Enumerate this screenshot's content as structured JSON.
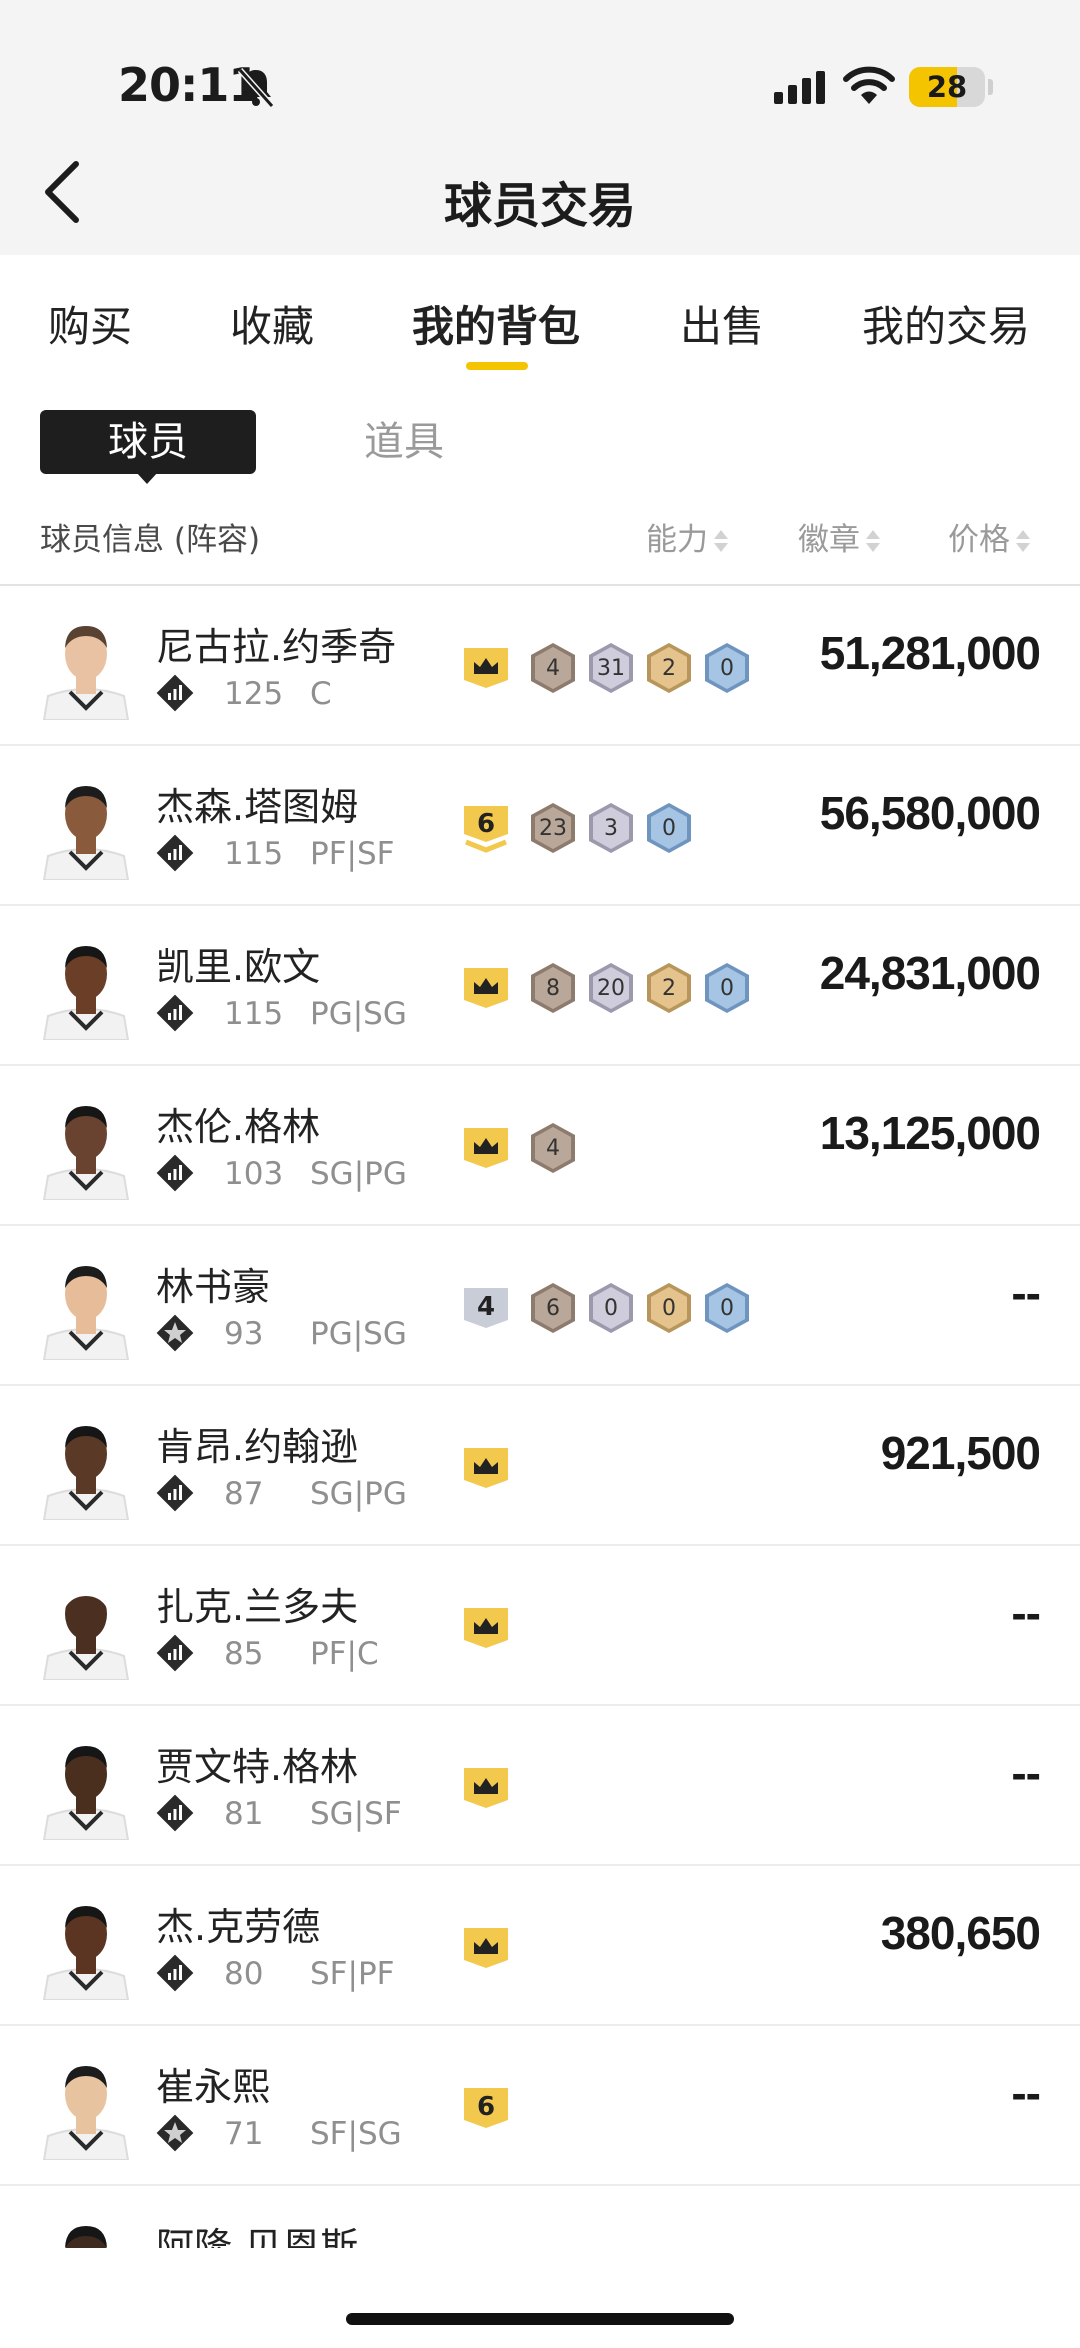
{
  "status_bar": {
    "time": "20:11",
    "battery": "28"
  },
  "header": {
    "title": "球员交易"
  },
  "tabs": [
    {
      "label": "购买"
    },
    {
      "label": "收藏"
    },
    {
      "label": "我的背包"
    },
    {
      "label": "出售"
    },
    {
      "label": "我的交易"
    }
  ],
  "segment": {
    "player": "球员",
    "items": "道具"
  },
  "columns": {
    "info": "球员信息 (阵容)",
    "ability": "能力",
    "badges": "徽章",
    "price": "价格"
  },
  "players": [
    {
      "name": "尼古拉.约季奇",
      "ovr": "125",
      "pos": "C",
      "rank": "diamond",
      "price": "51,281,000",
      "badges": [
        {
          "kind": "crown",
          "label": ""
        },
        {
          "kind": "bronze",
          "label": "4"
        },
        {
          "kind": "silver",
          "label": "31"
        },
        {
          "kind": "gold",
          "label": "2"
        },
        {
          "kind": "blue",
          "label": "0"
        }
      ]
    },
    {
      "name": "杰森.塔图姆",
      "ovr": "115",
      "pos": "PF|SF",
      "rank": "diamond",
      "price": "56,580,000",
      "badges": [
        {
          "kind": "level",
          "label": "6"
        },
        {
          "kind": "bronze",
          "label": "23"
        },
        {
          "kind": "silver",
          "label": "3"
        },
        {
          "kind": "blue",
          "label": "0"
        }
      ]
    },
    {
      "name": "凯里.欧文",
      "ovr": "115",
      "pos": "PG|SG",
      "rank": "diamond",
      "price": "24,831,000",
      "badges": [
        {
          "kind": "crown",
          "label": ""
        },
        {
          "kind": "bronze",
          "label": "8"
        },
        {
          "kind": "silver",
          "label": "20"
        },
        {
          "kind": "gold",
          "label": "2"
        },
        {
          "kind": "blue",
          "label": "0"
        }
      ]
    },
    {
      "name": "杰伦.格林",
      "ovr": "103",
      "pos": "SG|PG",
      "rank": "diamond",
      "price": "13,125,000",
      "badges": [
        {
          "kind": "crown",
          "label": ""
        },
        {
          "kind": "bronze",
          "label": "4"
        }
      ]
    },
    {
      "name": "林书豪",
      "ovr": "93",
      "pos": "PG|SG",
      "rank": "star",
      "price": "--",
      "badges": [
        {
          "kind": "tag",
          "label": "4"
        },
        {
          "kind": "bronze",
          "label": "6"
        },
        {
          "kind": "silver",
          "label": "0"
        },
        {
          "kind": "gold",
          "label": "0"
        },
        {
          "kind": "blue",
          "label": "0"
        }
      ]
    },
    {
      "name": "肯昂.约翰逊",
      "ovr": "87",
      "pos": "SG|PG",
      "rank": "diamond",
      "price": "921,500",
      "badges": [
        {
          "kind": "crown",
          "label": ""
        }
      ]
    },
    {
      "name": "扎克.兰多夫",
      "ovr": "85",
      "pos": "PF|C",
      "rank": "diamond",
      "price": "--",
      "badges": [
        {
          "kind": "crown",
          "label": ""
        }
      ]
    },
    {
      "name": "贾文特.格林",
      "ovr": "81",
      "pos": "SG|SF",
      "rank": "diamond",
      "price": "--",
      "badges": [
        {
          "kind": "crown",
          "label": ""
        }
      ]
    },
    {
      "name": "杰.克劳德",
      "ovr": "80",
      "pos": "SF|PF",
      "rank": "diamond",
      "price": "380,650",
      "badges": [
        {
          "kind": "crown",
          "label": ""
        }
      ]
    },
    {
      "name": "崔永熙",
      "ovr": "71",
      "pos": "SF|SG",
      "rank": "star",
      "price": "--",
      "badges": [
        {
          "kind": "flag",
          "label": "6"
        }
      ]
    },
    {
      "name": "阿隆.贝恩斯",
      "ovr": "",
      "pos": "",
      "rank": "none",
      "price": "",
      "badges": []
    }
  ],
  "colors": {
    "accent": "#f5c400",
    "bronze": "#b9a89a",
    "silver": "#c9c7d6",
    "gold": "#e2c38a",
    "blue": "#9fbfe0"
  }
}
